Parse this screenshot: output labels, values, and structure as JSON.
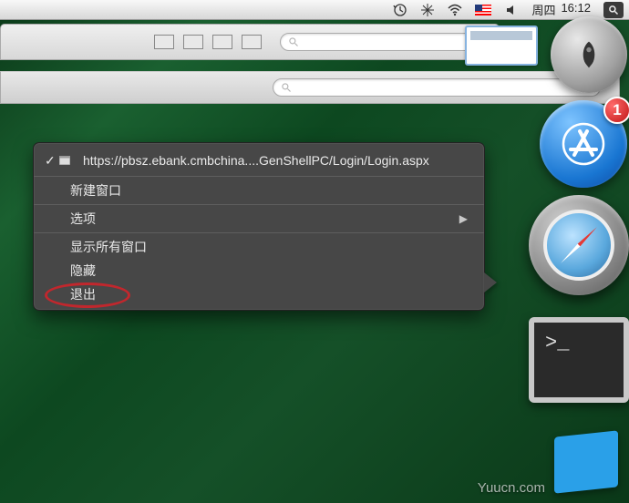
{
  "menubar": {
    "day": "周四",
    "time": "16:12"
  },
  "context_menu": {
    "page_title": "https://pbsz.ebank.cmbchina....GenShellPC/Login/Login.aspx",
    "new_window": "新建窗口",
    "options": "选项",
    "show_all_windows": "显示所有窗口",
    "hide": "隐藏",
    "quit": "退出"
  },
  "dock": {
    "terminal_prompt": ">_",
    "appstore_badge": "1"
  },
  "watermark": "Yuucn.com"
}
